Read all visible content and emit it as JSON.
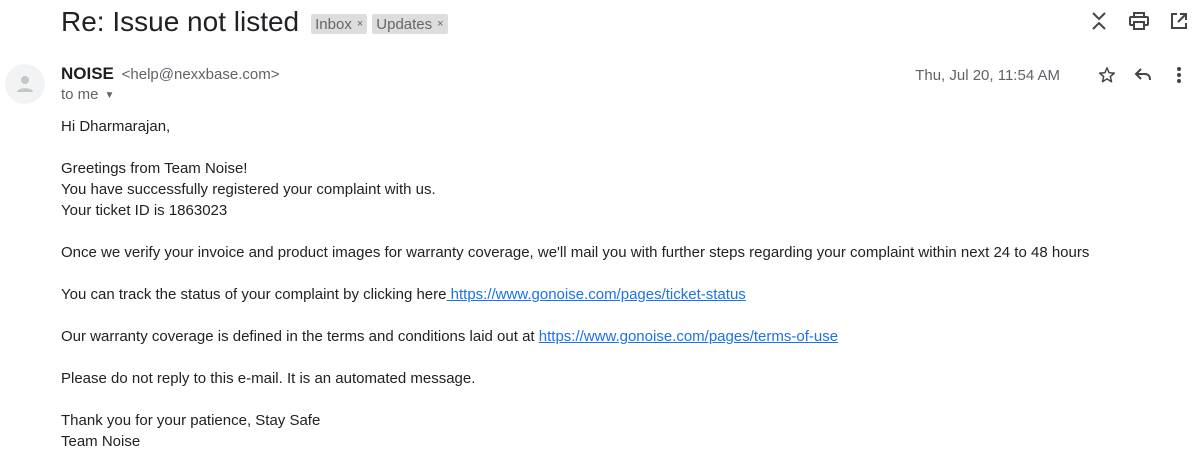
{
  "email": {
    "subject": "Re: Issue not listed",
    "labels": [
      {
        "text": "Inbox",
        "remove": "×"
      },
      {
        "text": "Updates",
        "remove": "×"
      }
    ],
    "sender_name": "NOISE",
    "sender_email": "<help@nexxbase.com>",
    "recipient": "to me",
    "date": "Thu, Jul 20, 11:54 AM"
  },
  "icons": {
    "collapse": "collapse-all-icon",
    "print": "print-icon",
    "open_new": "open-in-new-window-icon",
    "avatar": "person-avatar-icon",
    "star": "star-icon",
    "reply": "reply-icon",
    "more": "more-vert-icon"
  },
  "body": {
    "greeting": "Hi Dharmarajan,",
    "line1": "Greetings from Team Noise!",
    "line2": "You have successfully registered your complaint with us.",
    "line3": "Your ticket ID is 1863023",
    "para_verify": "Once we verify your invoice and product images for warranty coverage, we'll mail you with further steps regarding your complaint within next 24 to 48 hours",
    "track_text": "You can track the status of your complaint by clicking here",
    "track_link": " https://www.gonoise.com/pages/ticket-status",
    "warranty_text": "Our warranty coverage is defined in the terms and conditions laid out at ",
    "warranty_link": "https://www.gonoise.com/pages/terms-of-use",
    "no_reply": "Please do not reply to this e-mail. It is an automated message.",
    "thanks": "Thank you for your patience, Stay Safe",
    "signature": "Team Noise"
  },
  "colors": {
    "link": "#1a73e8",
    "label_bg": "#dddddd",
    "muted": "#5f6368"
  }
}
